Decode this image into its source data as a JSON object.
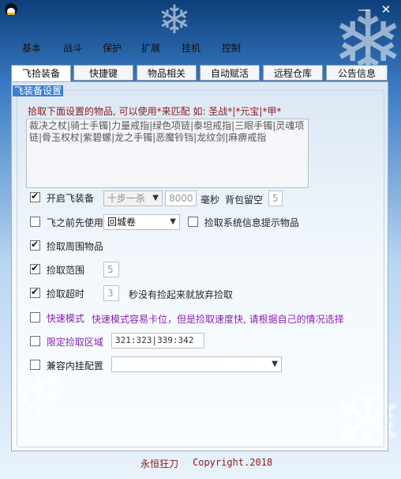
{
  "window": {
    "minimize": "—",
    "close": "✕"
  },
  "menu": [
    "基本",
    "战斗",
    "保护",
    "扩展",
    "挂机",
    "控制"
  ],
  "tabs": [
    "飞拾装备",
    "快捷键",
    "物品相关",
    "自动赋活",
    "远程仓库",
    "公告信息"
  ],
  "group_title": "飞装备设置",
  "hint": "拾取下面设置的物品, 可以使用*来匹配 如: 圣战*|*元宝|*甲*",
  "items_text": "裁决之杖|骑士手镯|力量戒指|绿色项链|泰坦戒指|三眼手镯|灵魂项链|骨玉权杖|紫碧螺|龙之手镯|恶魔铃铛|龙纹剑|麻痹戒指",
  "fly_equip": {
    "label": "开启飞装备",
    "checked": true,
    "mode": "十步一杀",
    "ms_value": "8000",
    "ms_label": "毫秒",
    "bag_label": "背包留空",
    "bag_value": "5"
  },
  "fly_before": {
    "label": "飞之前先使用",
    "checked": false,
    "item": "回城卷",
    "sys_label": "捡取系统信息提示物品",
    "sys_checked": false
  },
  "pick_around": {
    "label": "捡取周围物品",
    "checked": true
  },
  "pick_range": {
    "label": "捡取范围",
    "checked": true,
    "value": "5"
  },
  "pick_timeout": {
    "label": "捡取超时",
    "checked": true,
    "value": "3",
    "suffix": "秒没有捡起来就放弃捡取"
  },
  "fast_mode": {
    "label": "快速模式",
    "checked": false,
    "desc": "快速模式容易卡位，但是捡取速度快, 请根据自己的情况选择"
  },
  "limit_area": {
    "label": "限定捡取区域",
    "checked": false,
    "value": "321:323|339:342"
  },
  "compat": {
    "label": "兼容内挂配置",
    "checked": false,
    "value": ""
  },
  "footer": {
    "author": "永恒狂刀",
    "copyright": "Copyright.2018"
  },
  "colors": {
    "accent": "#3c7fd0",
    "hint": "#8b1a1a",
    "purple": "#8a1fb0"
  }
}
